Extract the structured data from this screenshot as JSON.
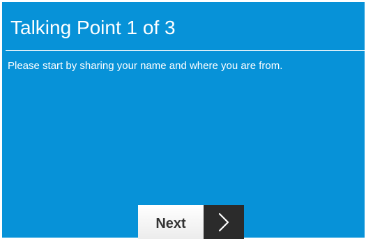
{
  "header": {
    "title": "Talking Point 1 of 3"
  },
  "content": {
    "prompt": "Please start by sharing your name and where you are from."
  },
  "footer": {
    "next_label": "Next",
    "next_icon": "chevron-right-icon"
  },
  "colors": {
    "panel_background": "#0792d8",
    "text": "#ffffff",
    "button_light": "#ffffff",
    "button_dark": "#2b2b2b"
  }
}
